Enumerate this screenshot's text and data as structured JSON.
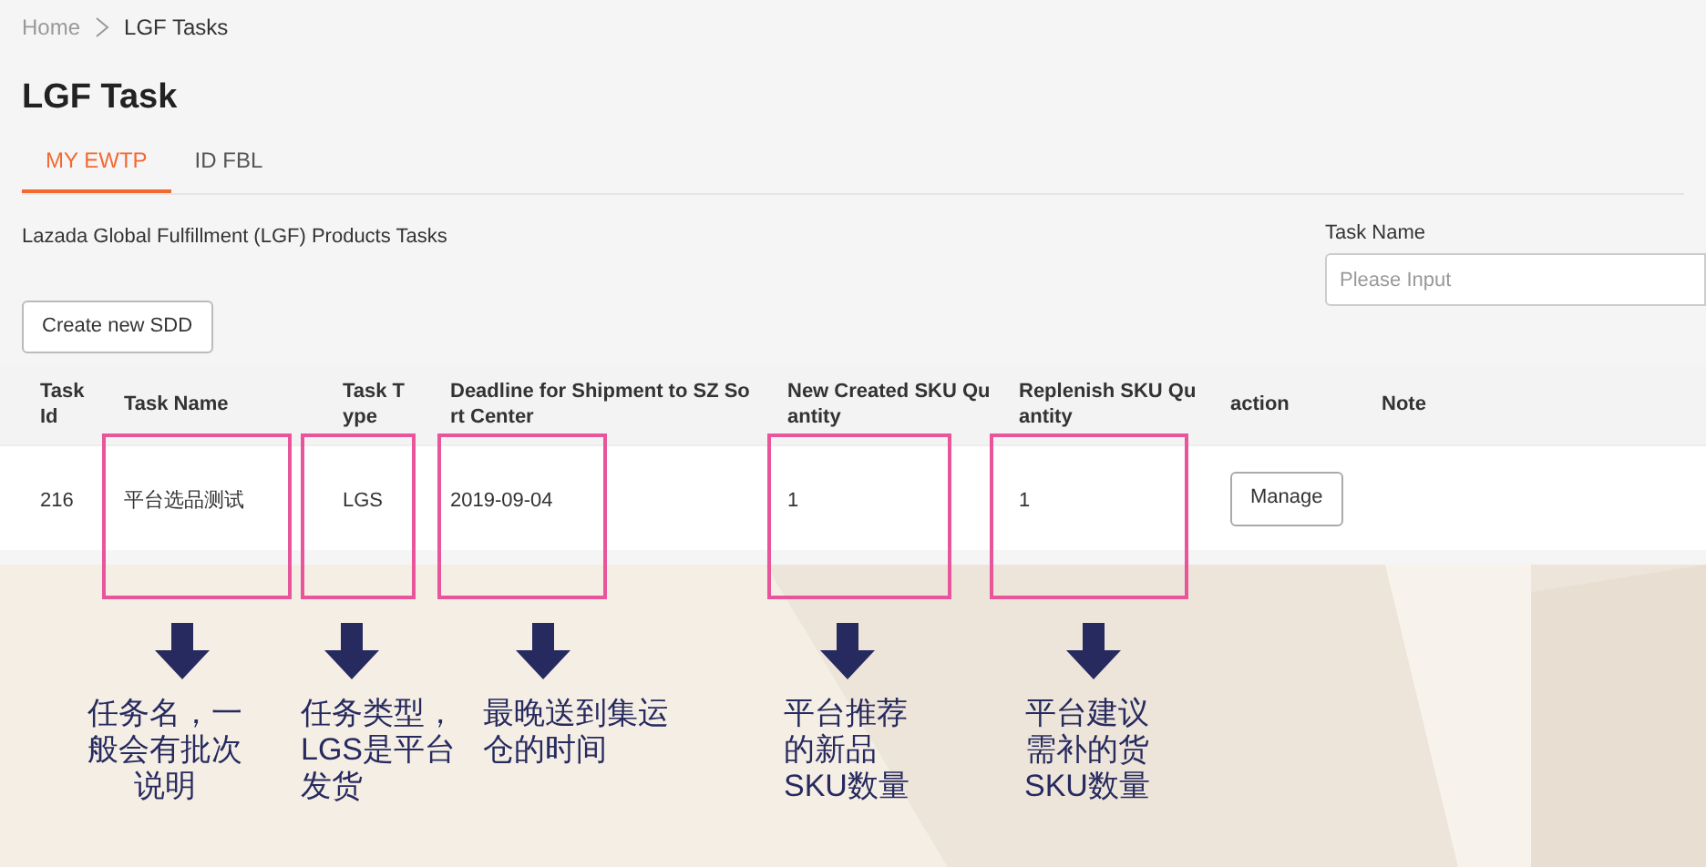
{
  "breadcrumb": [
    {
      "label": "Home",
      "selected": false
    },
    {
      "label": "LGF Tasks",
      "selected": true
    }
  ],
  "title": "LGF Task",
  "tabs": [
    {
      "label": "MY EWTP",
      "selected": true
    },
    {
      "label": "ID FBL",
      "selected": false
    }
  ],
  "description": "Lazada Global Fulfillment (LGF) Products Tasks",
  "filter": {
    "label": "Task Name",
    "placeholder": "Please Input"
  },
  "create_button": "Create new SDD",
  "table": {
    "columns": [
      {
        "lines": [
          "Task",
          "Id"
        ]
      },
      {
        "lines": [
          "Task Name"
        ]
      },
      {
        "lines": [
          "Task T",
          "ype"
        ]
      },
      {
        "lines": [
          "Deadline for Shipment to SZ So",
          "rt Center"
        ]
      },
      {
        "lines": [
          "New Created SKU Qu",
          "antity"
        ]
      },
      {
        "lines": [
          "Replenish SKU Qu",
          "antity"
        ]
      },
      {
        "lines": [
          "action"
        ]
      },
      {
        "lines": [
          "Note"
        ]
      }
    ],
    "rows": [
      {
        "task_id": "216",
        "task_name": "平台选品测试",
        "task_type": "LGS",
        "deadline": "2019-09-04",
        "new_created": "1",
        "replenish": "1",
        "action": "Manage"
      }
    ]
  },
  "annotations": [
    {
      "kind": "name",
      "lines": [
        "任务名，一",
        "般会有批次",
        "说明"
      ]
    },
    {
      "kind": "type",
      "lines": [
        "任务类型，",
        "LGS是平台",
        "发货"
      ]
    },
    {
      "kind": "deadline",
      "lines": [
        "最晚送到集运",
        "仓的时间"
      ]
    },
    {
      "kind": "new",
      "lines": [
        "平台推荐",
        "的新品",
        "SKU数量"
      ]
    },
    {
      "kind": "replenish",
      "lines": [
        "平台建议",
        "需补的货",
        "SKU数量"
      ]
    }
  ]
}
